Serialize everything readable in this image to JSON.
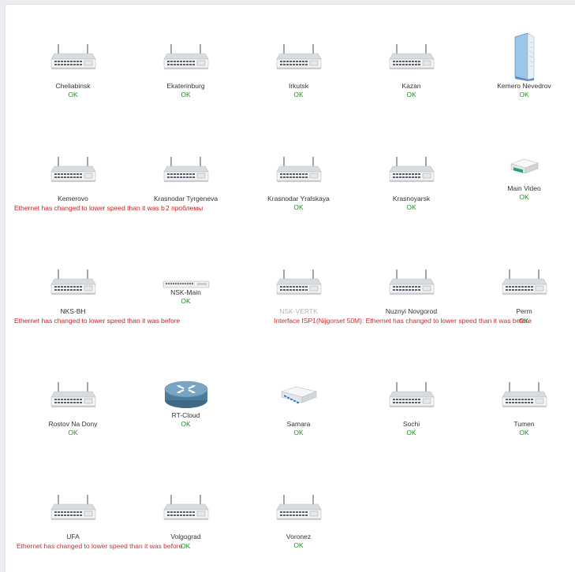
{
  "devices": [
    {
      "name": "Cheliabinsk",
      "status": "OK",
      "icon": "router-icon"
    },
    {
      "name": "Ekaterinburg",
      "status": "OK",
      "icon": "router-icon"
    },
    {
      "name": "Irkutsk",
      "status": "OK",
      "icon": "router-icon"
    },
    {
      "name": "Kazan",
      "status": "OK",
      "icon": "router-icon"
    },
    {
      "name": "Kemero Nevedrov",
      "status": "OK",
      "icon": "tower-router-icon"
    },
    {
      "name": "Kemerovo",
      "status": "Ethernet has changed to lower speed than it was before",
      "icon": "router-icon"
    },
    {
      "name": "Krasnodar Tyrgeneva",
      "status": "2 проблемы",
      "icon": "router-icon"
    },
    {
      "name": "Krasnodar Yralskaya",
      "status": "OK",
      "icon": "router-icon"
    },
    {
      "name": "Krasnoyarsk",
      "status": "OK",
      "icon": "router-icon"
    },
    {
      "name": "Main Video",
      "status": "OK",
      "icon": "small-router-icon"
    },
    {
      "name": "NKS-BH",
      "status": "Ethernet has changed to lower speed than it was before",
      "icon": "router-icon"
    },
    {
      "name": "NSK-Main",
      "status": "OK",
      "icon": "rack-switch-icon"
    },
    {
      "name": "NSK-VERTK",
      "status": "Interface ISP1(Nijgorset 50M): Ethernet has changed to lower speed than it was before",
      "icon": "router-icon"
    },
    {
      "name": "Nuznyi Novgorod",
      "status": "",
      "icon": "router-icon"
    },
    {
      "name": "Perm",
      "status": "OK",
      "icon": "router-icon"
    },
    {
      "name": "Rostov Na Dony",
      "status": "OK",
      "icon": "router-icon"
    },
    {
      "name": "RT-Cloud",
      "status": "OK",
      "icon": "cloud-router-icon"
    },
    {
      "name": "Samara",
      "status": "OK",
      "icon": "hex-router-icon"
    },
    {
      "name": "Sochi",
      "status": "OK",
      "icon": "router-icon"
    },
    {
      "name": "Tumen",
      "status": "OK",
      "icon": "router-icon"
    },
    {
      "name": "UFA",
      "status": "Ethernet has changed to lower speed than it was before",
      "icon": "router-icon"
    },
    {
      "name": "Volgograd",
      "status": "OK",
      "icon": "router-icon"
    },
    {
      "name": "Voronez",
      "status": "OK",
      "icon": "router-icon"
    }
  ],
  "colors": {
    "ok": "#1e8f1e",
    "warn": "#c62020",
    "text": "#333333"
  }
}
